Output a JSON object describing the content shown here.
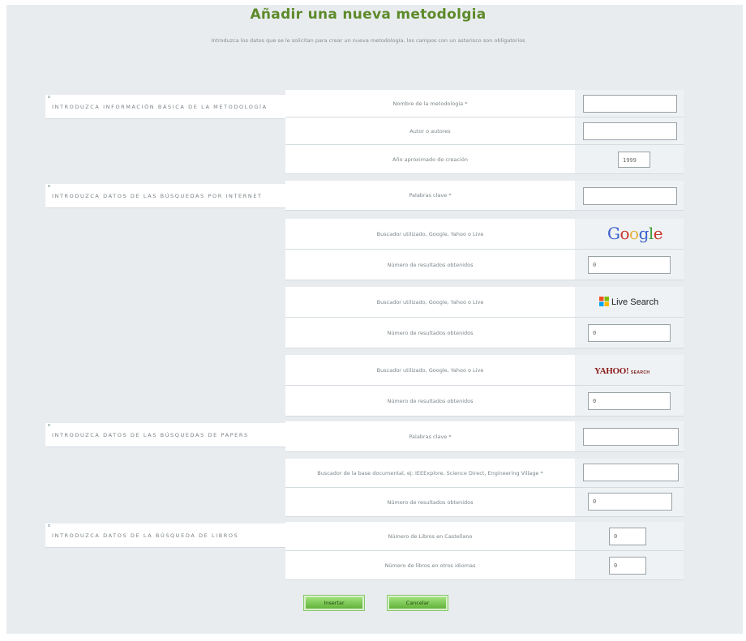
{
  "page": {
    "title": "Añadir una nueva metodolgia",
    "subtitle": "Introduzca los datos que se le solicitan para crear un nueva metodología, los campos con un asterisco son obligatorios"
  },
  "sections": {
    "basic": "INTRODUZCA INFORMACIÓN BÁSICA DE LA METODOLOGÍA",
    "internet": "INTRODUZCA DATOS DE LAS BÚSQUEDAS POR INTERNET",
    "papers": "INTRODUZCA DATOS DE LAS BÚSQUEDAS DE PAPERS",
    "books": "INTRODUZCA DATOS DE LA BÚSQUEDA DE LIBROS"
  },
  "fields": {
    "nombre_label": "Nombre de la metodologia *",
    "nombre_value": "",
    "autor_label": "Autor o autores",
    "autor_value": "",
    "anio_label": "Año aproximado de creación",
    "anio_value": "1999",
    "palabras_internet_label": "Palabras clave *",
    "palabras_internet_value": "",
    "buscador_label": "Buscador utilizado, Google, Yahoo o Live",
    "resultados_label": "Número de resultados obtenidos",
    "google_results": "0",
    "live_results": "0",
    "yahoo_results": "0",
    "palabras_papers_label": "Palabras clave *",
    "palabras_papers_value": "",
    "base_doc_label": "Buscador de la base documental, ej: IEEExplore, Science Direct, Engineering Village *",
    "base_doc_value": "",
    "papers_results": "0",
    "libros_castellano_label": "Número de Libros en Castellano",
    "libros_castellano_value": "0",
    "libros_otros_label": "Número de libros en otros idiomas",
    "libros_otros_value": "0"
  },
  "logos": {
    "google": [
      "G",
      "o",
      "o",
      "g",
      "l",
      "e"
    ],
    "google_colors": [
      "#3a5fcd",
      "#c8362c",
      "#e3b33c",
      "#3a5fcd",
      "#3f9c3a",
      "#c8362c"
    ],
    "live": "Live Search",
    "yahoo": "YAHOO!",
    "yahoo_sub": "SEARCH"
  },
  "buttons": {
    "insert": "Insertar",
    "cancel": "Cancelar"
  }
}
